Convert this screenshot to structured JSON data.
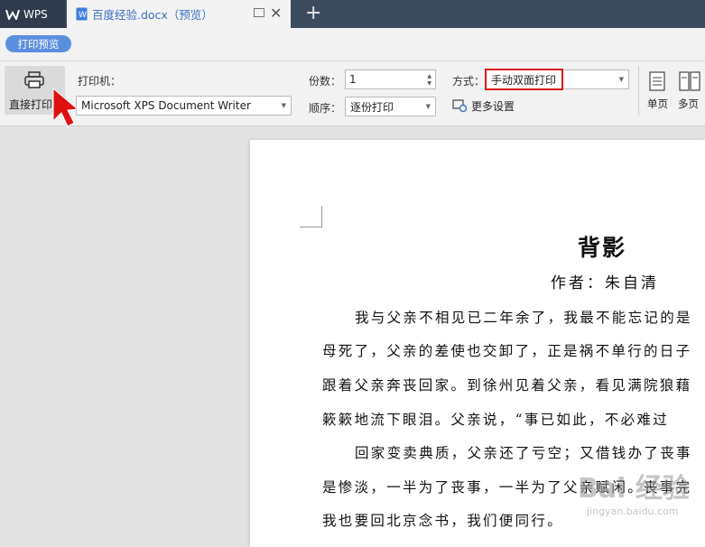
{
  "tabs": {
    "app_label": "WPS",
    "doc_label": "百度经验.docx（预览）",
    "add_symbol": "+",
    "close_symbol": "✕"
  },
  "toolbar": {
    "preview_label": "打印预览",
    "direct_print_label": "直接打印",
    "printer_label": "打印机：",
    "printer_value": "Microsoft XPS Document Writer",
    "copies_label": "份数：",
    "copies_value": "1",
    "order_label": "顺序：",
    "order_value": "逐份打印",
    "mode_label": "方式：",
    "mode_value": "手动双面打印",
    "more_settings_label": "更多设置",
    "single_page_label": "单页",
    "multi_page_label": "多页"
  },
  "document": {
    "title": "背影",
    "author": "作者：朱自清",
    "lines": [
      "我与父亲不相见已二年余了，我最不能忘记的是",
      "母死了，父亲的差使也交卸了，正是祸不单行的日子",
      "跟着父亲奔丧回家。到徐州见着父亲，看见满院狼藉",
      "簌簌地流下眼泪。父亲说，“事已如此，不必难过",
      "回家变卖典质，父亲还了亏空；又借钱办了丧事",
      "是惨淡，一半为了丧事，一半为了父亲赋闲。丧事完",
      "我也要回北京念书，我们便同行。"
    ]
  },
  "watermark": {
    "text": "Bai 经验",
    "sub": "jingyan.baidu.com"
  },
  "colors": {
    "accent": "#5a8ede",
    "highlight_border": "#d9181e",
    "tabbar": "#3c4a5e"
  }
}
